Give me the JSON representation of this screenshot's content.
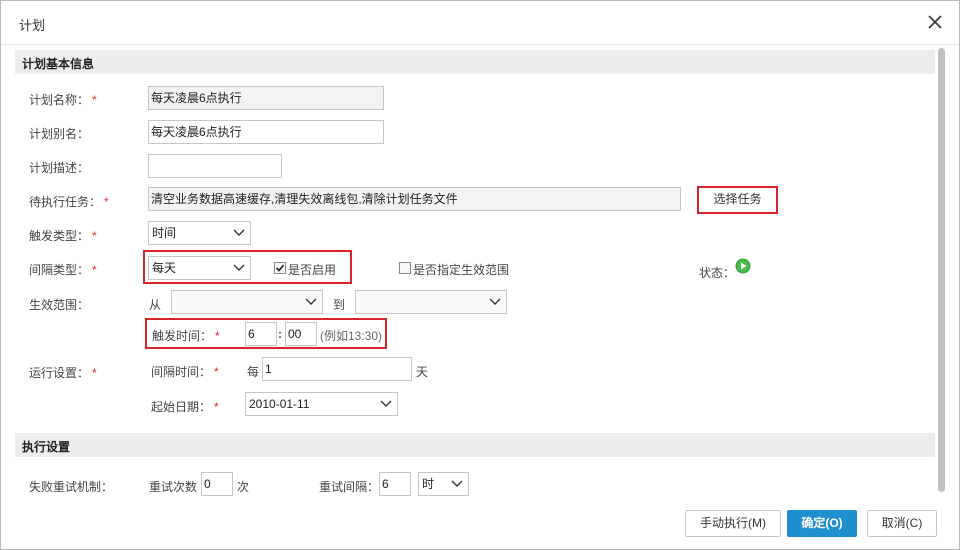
{
  "window": {
    "title": "计划"
  },
  "section_basic": {
    "title": "计划基本信息"
  },
  "plan_name": {
    "label": "计划名称：",
    "value": "每天凌晨6点执行"
  },
  "plan_alias": {
    "label": "计划别名：",
    "value": "每天凌晨6点执行"
  },
  "plan_desc": {
    "label": "计划描述：",
    "value": ""
  },
  "pending_task": {
    "label": "待执行任务：",
    "value": "清空业务数据高速缓存,清理失效离线包,清除计划任务文件",
    "select_button": "选择任务"
  },
  "trigger_type": {
    "label": "触发类型：",
    "value": "时间"
  },
  "interval_type": {
    "label": "间隔类型：",
    "value": "每天",
    "enabled_label": "是否启用",
    "enabled": true,
    "range_label": "是否指定生效范围",
    "range_enabled": false,
    "status_label": "状态："
  },
  "effective_range": {
    "label": "生效范围：",
    "from": "从",
    "to": "到",
    "from_value": "",
    "to_value": ""
  },
  "trigger_time": {
    "label": "触发时间：",
    "hour": "6",
    "colon": ":",
    "minute": "00",
    "hint": "(例如13:30)"
  },
  "run_settings": {
    "label": "运行设置：",
    "interval_label": "间隔时间：",
    "every": "每",
    "interval_value": "1",
    "unit": "天",
    "start_label": "起始日期：",
    "start_value": "2010-01-11"
  },
  "section_exec": {
    "title": "执行设置"
  },
  "retry": {
    "label": "失败重试机制：",
    "count_label": "重试次数",
    "count_value": "0",
    "count_unit": "次",
    "interval_label": "重试间隔：",
    "interval_value": "6",
    "interval_unit": "时"
  },
  "footer": {
    "manual": "手动执行(M)",
    "ok": "确定(O)",
    "cancel": "取消(C)"
  },
  "colors": {
    "required": "#e0262d",
    "primary": "#1f8fcf",
    "highlight": "#d9262c",
    "status_green": "#3aa53a"
  },
  "icons": {
    "close": "close-icon",
    "dropdown": "chevron-down-icon",
    "status": "play-circle-icon",
    "check": "checkmark-icon"
  }
}
